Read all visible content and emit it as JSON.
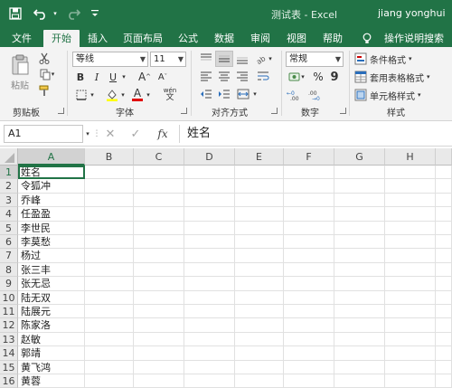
{
  "title_bar": {
    "document_title": "测试表 - Excel",
    "user": "jiang yonghui",
    "icons": [
      "save-icon",
      "undo-icon",
      "redo-icon",
      "customize-qat-icon"
    ]
  },
  "tabs": [
    {
      "label": "文件",
      "active": false
    },
    {
      "label": "开始",
      "active": true
    },
    {
      "label": "插入",
      "active": false
    },
    {
      "label": "页面布局",
      "active": false
    },
    {
      "label": "公式",
      "active": false
    },
    {
      "label": "数据",
      "active": false
    },
    {
      "label": "审阅",
      "active": false
    },
    {
      "label": "视图",
      "active": false
    },
    {
      "label": "帮助",
      "active": false
    },
    {
      "label": "操作说明搜索",
      "active": false
    }
  ],
  "ribbon": {
    "clipboard": {
      "label": "剪贴板",
      "paste": "粘贴"
    },
    "font": {
      "label": "字体",
      "font_name": "等线",
      "font_size": "11",
      "bold": "B",
      "italic": "I",
      "underline": "U",
      "grow": "A",
      "shrink": "A",
      "font_color": "A",
      "wen": "wén"
    },
    "alignment": {
      "label": "对齐方式"
    },
    "number": {
      "label": "数字",
      "format": "常规",
      "percent": "%",
      "comma": "9"
    },
    "styles": {
      "label": "样式",
      "conditional_format": "条件格式",
      "format_table": "套用表格格式",
      "cell_styles": "单元格样式"
    }
  },
  "formula_bar": {
    "name_box": "A1",
    "fx": "fx",
    "content": "姓名"
  },
  "sheet": {
    "columns": [
      "A",
      "B",
      "C",
      "D",
      "E",
      "F",
      "G",
      "H"
    ],
    "row_numbers": [
      "1",
      "2",
      "3",
      "4",
      "5",
      "6",
      "7",
      "8",
      "9",
      "10",
      "11",
      "12",
      "13",
      "14",
      "15",
      "16"
    ],
    "col_a": [
      "姓名",
      "令狐冲",
      "乔峰",
      "任盈盈",
      "李世民",
      "李莫愁",
      "杨过",
      "张三丰",
      "张无忌",
      "陆无双",
      "陆展元",
      "陈家洛",
      "赵敏",
      "郭靖",
      "黄飞鸿",
      "黄蓉"
    ]
  },
  "colors": {
    "accent": "#217346",
    "ribbon_bg": "#f3f3f3",
    "header_bg": "#e9e9e9"
  }
}
